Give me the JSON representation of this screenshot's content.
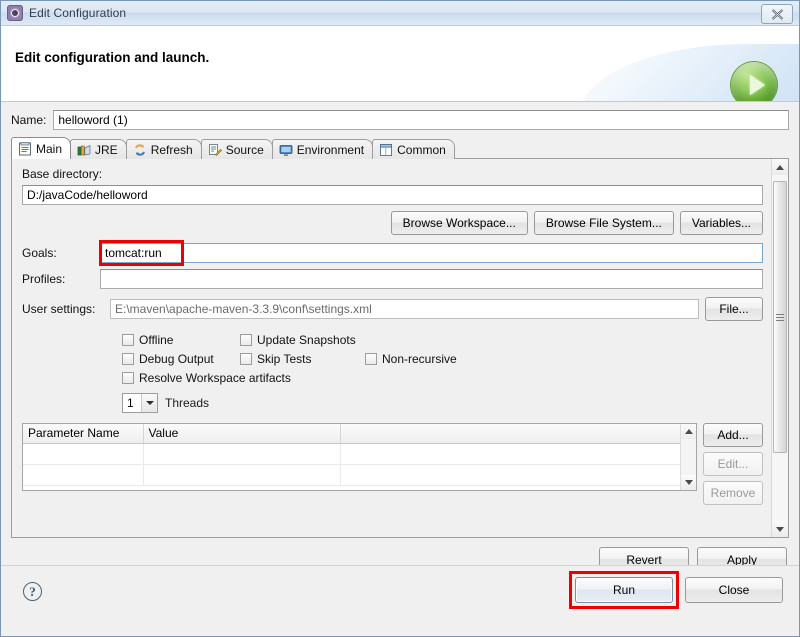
{
  "window": {
    "title": "Edit Configuration",
    "icon": "configuration-gear-icon",
    "close_label": "✕"
  },
  "header": {
    "title": "Edit configuration and launch.",
    "run_orb_icon": "run-play-icon"
  },
  "name_field": {
    "label": "Name:",
    "value": "helloword (1)"
  },
  "tabs": [
    {
      "label": "Main",
      "icon": "main-document-icon",
      "selected": true
    },
    {
      "label": "JRE",
      "icon": "jre-books-icon",
      "selected": false
    },
    {
      "label": "Refresh",
      "icon": "refresh-arrows-icon",
      "selected": false
    },
    {
      "label": "Source",
      "icon": "source-edit-icon",
      "selected": false
    },
    {
      "label": "Environment",
      "icon": "environment-monitor-icon",
      "selected": false
    },
    {
      "label": "Common",
      "icon": "common-window-icon",
      "selected": false
    }
  ],
  "main_tab": {
    "base_directory": {
      "label": "Base directory:",
      "value": "D:/javaCode/helloword"
    },
    "browse_buttons": [
      {
        "label": "Browse Workspace..."
      },
      {
        "label": "Browse File System..."
      },
      {
        "label": "Variables..."
      }
    ],
    "goals": {
      "label": "Goals:",
      "value": "tomcat:run",
      "highlighted": true,
      "highlight_color": "#ee0000"
    },
    "profiles": {
      "label": "Profiles:",
      "value": ""
    },
    "user_settings": {
      "label": "User settings:",
      "value": "E:\\maven\\apache-maven-3.3.9\\conf\\settings.xml",
      "button_label": "File..."
    },
    "checkboxes": [
      {
        "label": "Offline",
        "checked": false
      },
      {
        "label": "Update Snapshots",
        "checked": false
      },
      {
        "label": "Debug Output",
        "checked": false
      },
      {
        "label": "Skip Tests",
        "checked": false
      },
      {
        "label": "Non-recursive",
        "checked": false
      },
      {
        "label": "Resolve Workspace artifacts",
        "checked": false
      }
    ],
    "threads": {
      "value": "1",
      "label": "Threads"
    },
    "parameters_table": {
      "columns": [
        "Parameter Name",
        "Value"
      ],
      "rows": []
    },
    "table_buttons": [
      {
        "label": "Add...",
        "enabled": true
      },
      {
        "label": "Edit...",
        "enabled": false
      },
      {
        "label": "Remove",
        "enabled": false
      }
    ]
  },
  "apply_bar": {
    "revert_label": "Revert",
    "apply_label": "Apply"
  },
  "footer": {
    "help_icon": "help-question-icon",
    "help_glyph": "?",
    "run_label": "Run",
    "close_label": "Close",
    "run_highlighted": true,
    "highlight_color": "#ee0000"
  }
}
